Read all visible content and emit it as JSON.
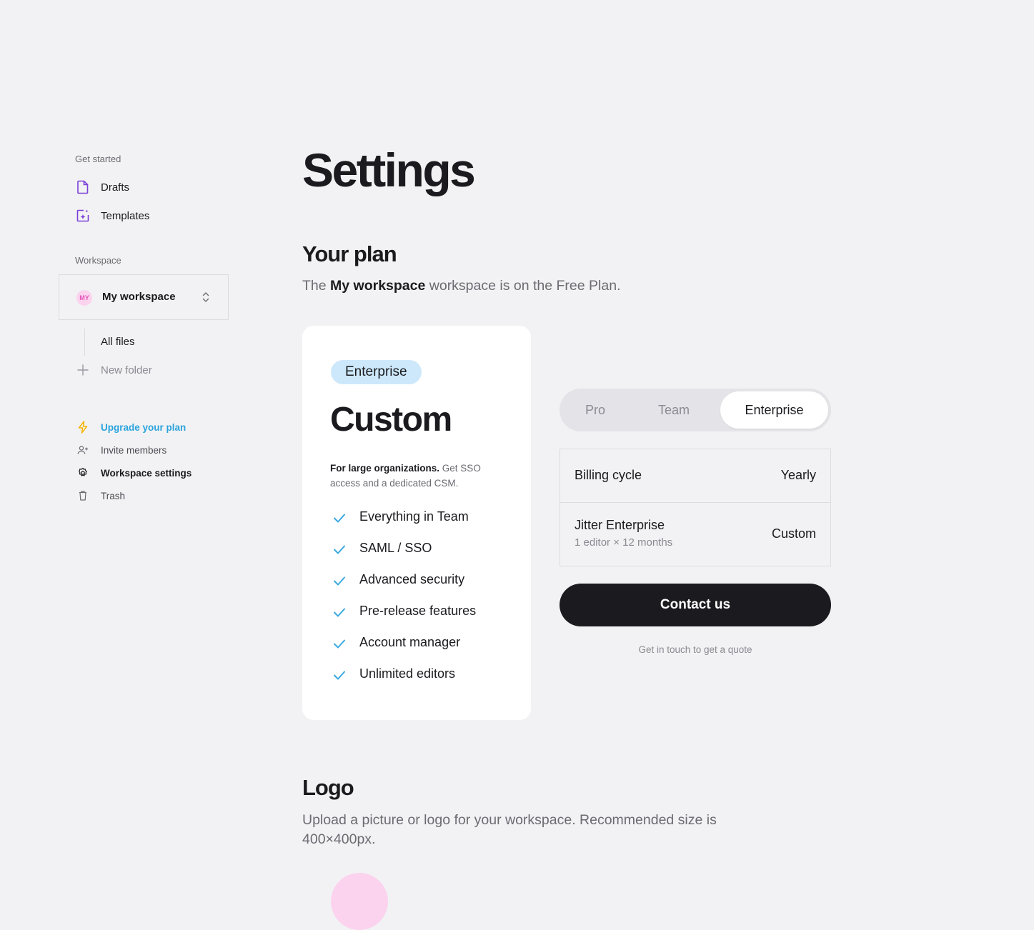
{
  "sidebar": {
    "get_started_label": "Get started",
    "drafts": {
      "label": "Drafts",
      "icon": "document-icon"
    },
    "templates": {
      "label": "Templates",
      "icon": "sparkle-template-icon"
    },
    "workspace_label": "Workspace",
    "workspace_selector": {
      "avatar_text": "MY",
      "name": "My workspace"
    },
    "all_files": "All files",
    "new_folder": "New folder",
    "actions": {
      "upgrade": "Upgrade your plan",
      "invite": "Invite members",
      "settings": "Workspace settings",
      "trash": "Trash"
    }
  },
  "main": {
    "title": "Settings",
    "plan": {
      "heading": "Your plan",
      "desc_prefix": "The",
      "desc_workspace": "My workspace",
      "desc_suffix": "workspace is on the Free Plan.",
      "card": {
        "badge": "Enterprise",
        "price": "Custom",
        "desc_bold": "For large organizations.",
        "desc_rest": "Get SSO access and a dedicated CSM.",
        "features": [
          "Everything in Team",
          "SAML / SSO",
          "Advanced security",
          "Pre-release features",
          "Account manager",
          "Unlimited editors"
        ]
      },
      "tabs": [
        "Pro",
        "Team",
        "Enterprise"
      ],
      "active_tab": "Enterprise",
      "summary": {
        "billing_label": "Billing cycle",
        "billing_value": "Yearly",
        "item_label": "Jitter Enterprise",
        "item_sub": "1 editor × 12 months",
        "item_value": "Custom"
      },
      "contact_button": "Contact us",
      "contact_note": "Get in touch to get a quote"
    },
    "logo": {
      "heading": "Logo",
      "desc": "Upload a picture or logo for your workspace. Recommended size is 400×400px."
    }
  },
  "colors": {
    "background": "#f2f2f4",
    "accent_purple": "#7b3fd8",
    "upgrade_blue": "#2aa3dc",
    "check_blue": "#3aa9e0",
    "badge_bg": "#cde8fb",
    "button_dark": "#1b1b1f",
    "avatar_pink": "#fbd3ee"
  }
}
